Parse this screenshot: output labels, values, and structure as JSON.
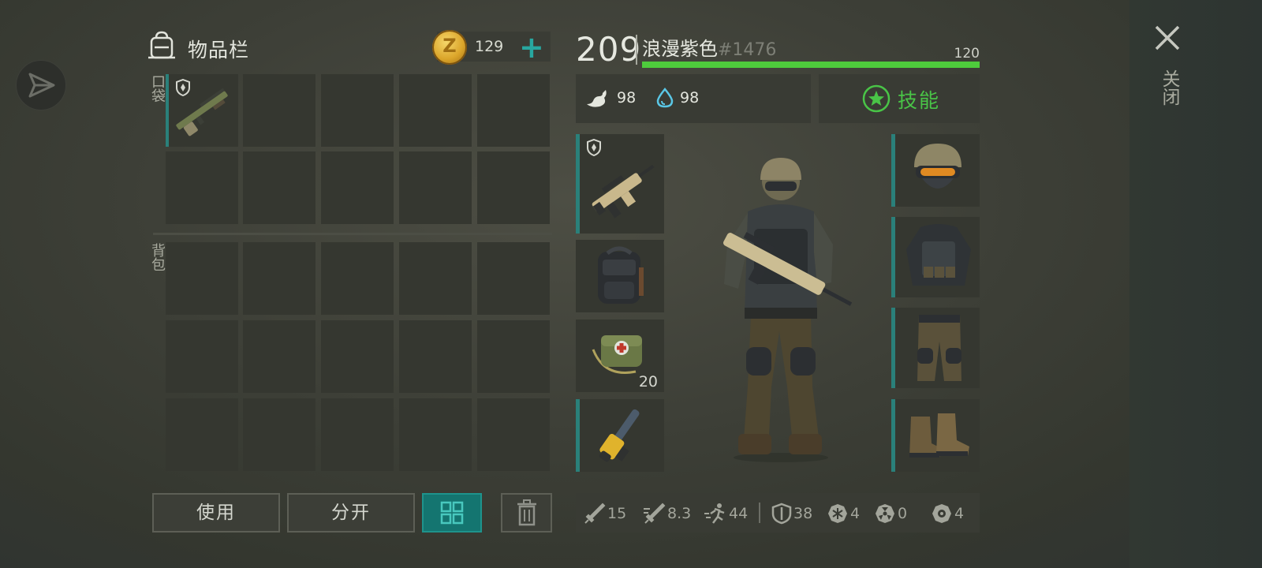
{
  "inventory": {
    "title": "物品栏",
    "currency": {
      "icon": "z-coin-icon",
      "amount": "129",
      "add_icon": "plus-icon"
    },
    "pockets_label": "口袋",
    "backpack_label": "背包",
    "pocket_items": [
      {
        "slot": 0,
        "icon": "shotgun-icon",
        "protected": true
      }
    ]
  },
  "actions": {
    "use_label": "使用",
    "split_label": "分开",
    "grid_icon": "grid-view-icon",
    "trash_icon": "trash-icon"
  },
  "character": {
    "level": "209",
    "name": "浪漫紫色",
    "id": "#1476",
    "hp": "120",
    "hp_fraction": 1.0,
    "food": "98",
    "water": "98",
    "skills_label": "技能"
  },
  "equipment": {
    "left": [
      {
        "icon": "rifle-icon",
        "protected": true
      },
      {
        "icon": "backpack-icon"
      },
      {
        "icon": "medkit-bag-icon",
        "count": "20"
      },
      {
        "icon": "chainsaw-icon"
      }
    ],
    "right": [
      {
        "icon": "helmet-icon"
      },
      {
        "icon": "tactical-vest-icon"
      },
      {
        "icon": "tactical-pants-icon"
      },
      {
        "icon": "boots-icon"
      }
    ]
  },
  "stats": {
    "melee": "15",
    "attack_speed": "8.3",
    "move_speed": "44",
    "armor": "38",
    "cold": "4",
    "radiation": "0",
    "infection": "4"
  },
  "close_label": "关闭",
  "colors": {
    "accent": "#1a8c85",
    "hp": "#4ecb3c",
    "skills": "#49c447"
  }
}
